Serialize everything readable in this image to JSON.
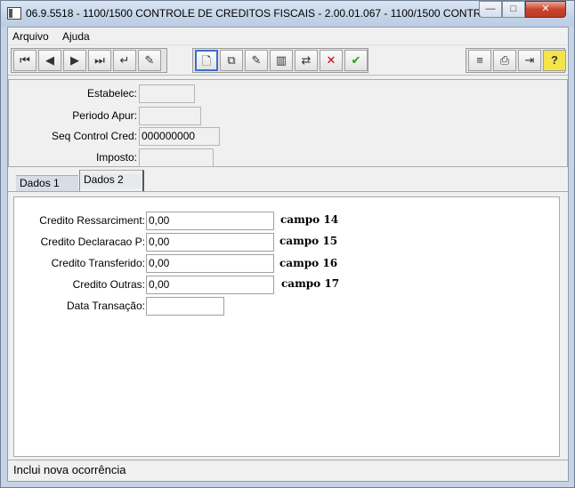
{
  "window": {
    "title": "06.9.5518 - 1100/1500 CONTROLE DE CREDITOS FISCAIS - 2.00.01.067 - 1100/1500 CONTROL...",
    "min_glyph": "—",
    "max_glyph": "□",
    "close_glyph": "✕"
  },
  "menu": {
    "arquivo": "Arquivo",
    "ajuda": "Ajuda"
  },
  "toolbar": {
    "first": "⏮",
    "prev": "◀",
    "next": "▶",
    "last": "⏭",
    "goto": "↵",
    "search": "✎",
    "new": "🗋",
    "copy": "⧉",
    "edit": "✎",
    "trash": "▥",
    "undo": "⇄",
    "delete": "✕",
    "confirm": "✔",
    "tree": "≡",
    "print": "⎙",
    "exit": "⇥",
    "help": "?"
  },
  "header": {
    "estabelec_label": "Estabelec:",
    "estabelec_value": "",
    "periodo_label": "Periodo Apur:",
    "periodo_value": "",
    "seq_label": "Seq Control Cred:",
    "seq_value": "000000000",
    "imposto_label": "Imposto:",
    "imposto_value": ""
  },
  "tabs": {
    "dados1": "Dados 1",
    "dados2": "Dados 2"
  },
  "form": {
    "ressarcimento_label": "Credito Ressarciment:",
    "ressarcimento_value": "0,00",
    "ressarcimento_campo": "campo 14",
    "declaracao_label": "Credito Declaracao P:",
    "declaracao_value": "0,00",
    "declaracao_campo": "campo 15",
    "transferido_label": "Credito Transferido:",
    "transferido_value": "0,00",
    "transferido_campo": "campo 16",
    "outras_label": "Credito Outras:",
    "outras_value": "0,00",
    "outras_campo": "campo 17",
    "data_label": "Data Transação:",
    "data_value": ""
  },
  "status": {
    "text": "Inclui nova ocorrência"
  }
}
